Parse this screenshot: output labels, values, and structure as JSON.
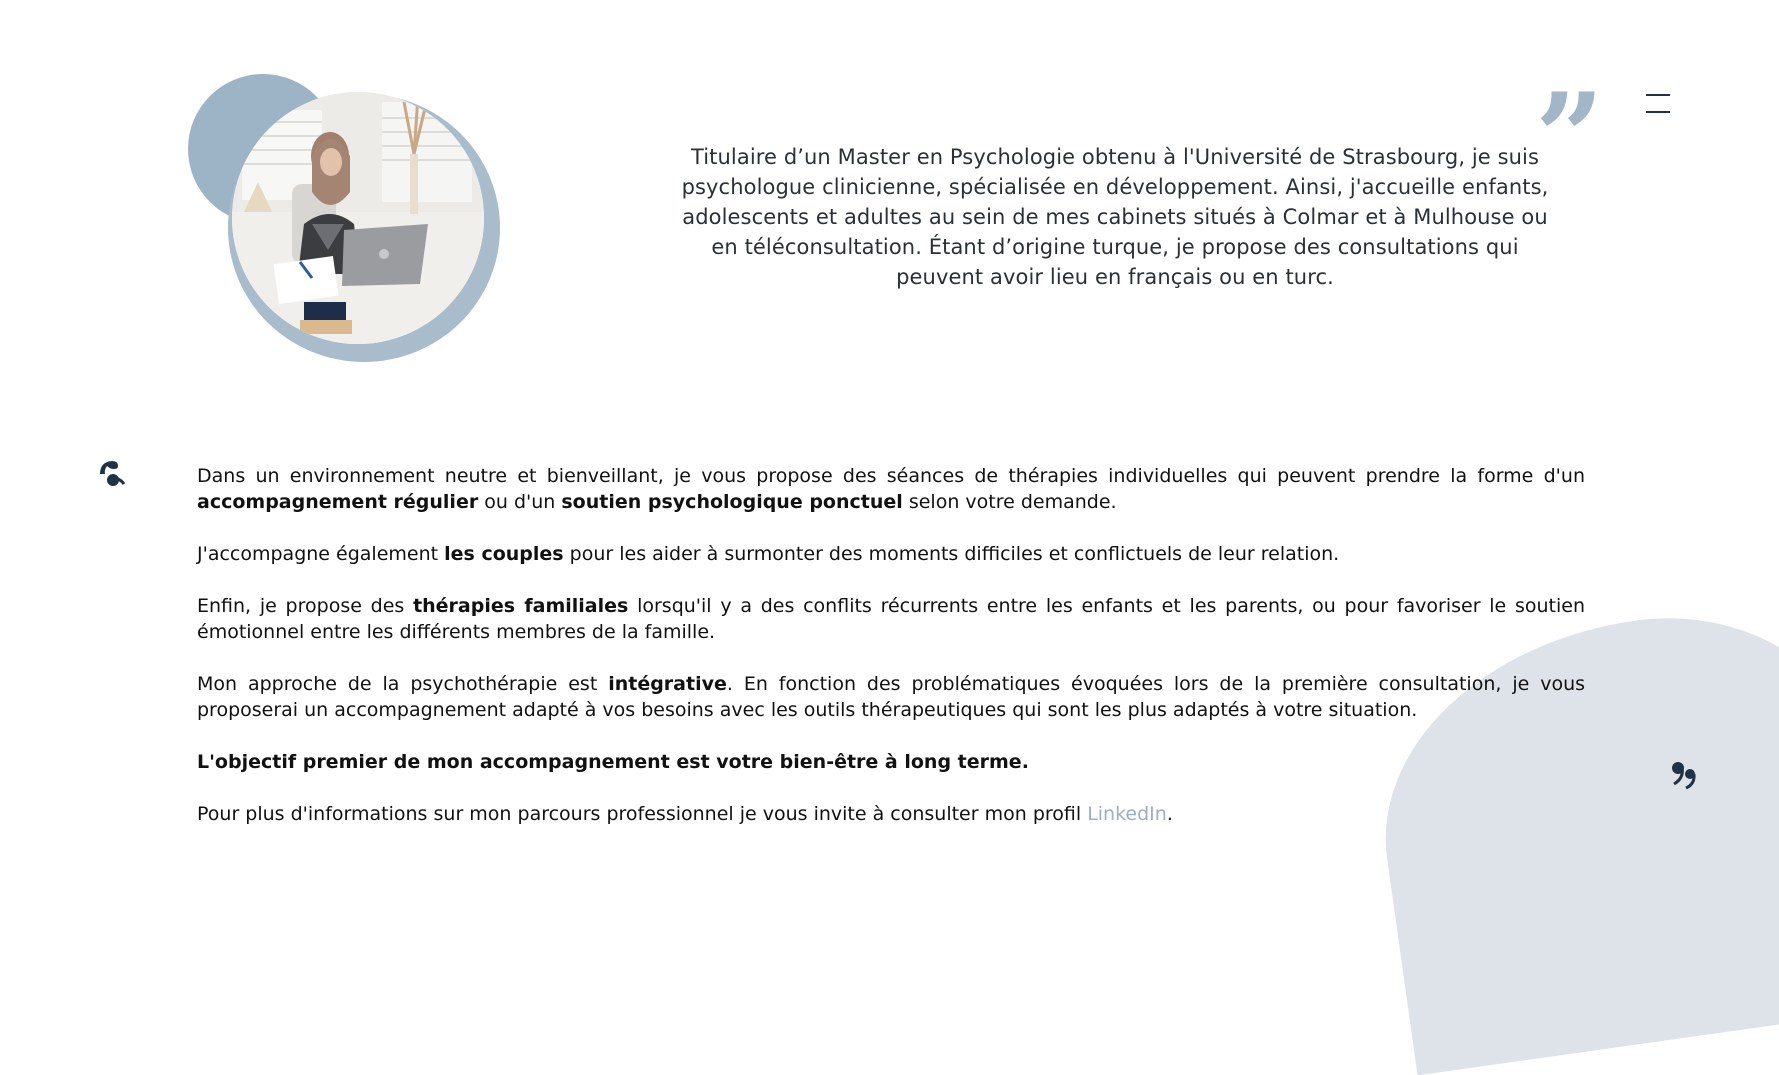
{
  "intro": {
    "text": "Titulaire d’un Master en Psychologie obtenu à l'Université de Strasbourg, je suis psychologue clinicienne, spécialisée en développement. Ainsi, j'accueille enfants, adolescents et adultes au sein de mes cabinets situés à Colmar et à Mulhouse ou en téléconsultation. Étant d’origine turque, je propose des consultations qui peuvent avoir lieu en français ou en turc."
  },
  "quote_mark": "”",
  "content": {
    "p1": {
      "a": "Dans un environnement neutre et bienveillant, je vous propose des séances de thérapies individuelles qui peuvent prendre la forme d'un ",
      "b1": "accompagnement régulier",
      "c": " ou d'un ",
      "b2": "soutien psychologique ponctuel",
      "d": " selon votre demande."
    },
    "p2": {
      "a": "J'accompagne également ",
      "b": "les couples",
      "c": " pour les aider à surmonter des moments difficiles et conflictuels de leur relation."
    },
    "p3": {
      "a": "Enfin, je propose des ",
      "b": "thérapies familiales",
      "c": " lorsqu'il y a des conflits récurrents entre les enfants et les parents, ou pour favoriser le soutien émotionnel entre les différents membres de la famille."
    },
    "p4": {
      "a": "Mon approche de la psychothérapie est ",
      "b": "intégrative",
      "c": ". En fonction des problématiques évoquées lors de la première consultation, je vous proposerai un accompagnement adapté à vos besoins avec les outils thérapeutiques qui sont les plus adaptés à votre situation."
    },
    "p5": "L'objectif premier de mon accompagnement est votre bien-être à long terme.",
    "p6": {
      "a": "Pour plus d'informations sur mon parcours professionnel je vous invite à consulter mon profil ",
      "link": "LinkedIn",
      "c": "."
    }
  },
  "colors": {
    "accent": "#9db3c6",
    "blob": "#dde3e8",
    "text": "#111111",
    "link": "#9bb0c2",
    "icon": "#1f3344"
  },
  "icons": [
    "menu-icon",
    "quote-icon",
    "comma-open-icon",
    "comma-close-icon"
  ]
}
